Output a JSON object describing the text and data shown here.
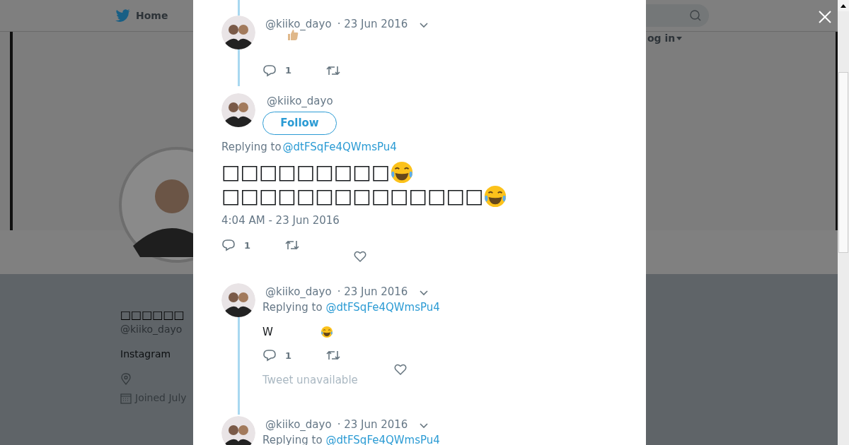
{
  "nav": {
    "home": "Home",
    "login": "og in"
  },
  "profile": {
    "name": "□□□□□□",
    "handle": "@kiiko_dayo",
    "bio": "Instagram",
    "joined": "Joined July"
  },
  "tweets": [
    {
      "kind": "compact",
      "handle": "@kiiko_dayo",
      "date": "· 23 Jun 2016",
      "thumbs_up_icon": true,
      "replies": "1"
    },
    {
      "kind": "main",
      "handle": "@kiiko_dayo",
      "follow": "Follow",
      "replying_label": "Replying to",
      "replying_to": "@dtFSqFe4QWmsPu4",
      "lines": [
        "□□□□□□□□□",
        "□□□□□□□□□□□□□□"
      ],
      "time": "4:04 AM - 23 Jun 2016",
      "replies": "1"
    },
    {
      "kind": "compact",
      "handle": "@kiiko_dayo",
      "date": "· 23 Jun 2016",
      "replying_label": "Replying to",
      "replying_to": "@dtFSqFe4QWmsPu4",
      "body": "W",
      "laugh_icon": true,
      "replies": "1",
      "note": "Tweet unavailable"
    },
    {
      "kind": "compact",
      "handle": "@kiiko_dayo",
      "date": "· 23 Jun 2016",
      "replying_label": "Replying to",
      "replying_to": "@dtFSqFe4QWmsPu4"
    }
  ]
}
